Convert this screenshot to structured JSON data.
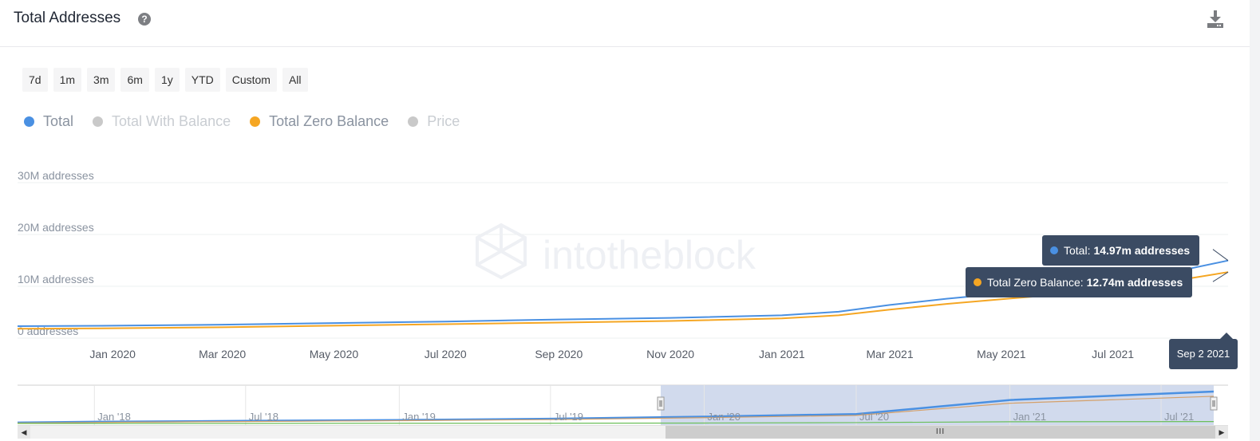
{
  "header": {
    "title": "Total Addresses",
    "help_icon": "question-circle-icon",
    "download_icon": "download-icon"
  },
  "range_buttons": [
    "7d",
    "1m",
    "3m",
    "6m",
    "1y",
    "YTD",
    "Custom",
    "All"
  ],
  "legend": [
    {
      "label": "Total",
      "color": "#4a90e2",
      "visible": true
    },
    {
      "label": "Total With Balance",
      "color": "#c9c9c9",
      "visible": false
    },
    {
      "label": "Total Zero Balance",
      "color": "#f5a623",
      "visible": true
    },
    {
      "label": "Price",
      "color": "#c9c9c9",
      "visible": false
    }
  ],
  "watermark": "intotheblock",
  "tooltip": {
    "total_label": "Total:",
    "total_value": "14.97m addresses",
    "zero_label": "Total Zero Balance:",
    "zero_value": "12.74m addresses",
    "date": "Sep 2 2021"
  },
  "chart_data": {
    "type": "line",
    "title": "Total Addresses",
    "xlabel": "",
    "ylabel": "",
    "y_ticks": [
      "0 addresses",
      "10M addresses",
      "20M addresses",
      "30M addresses"
    ],
    "ylim": [
      0,
      30
    ],
    "y_unit": "million addresses",
    "x_ticks": [
      "Jan 2020",
      "Mar 2020",
      "May 2020",
      "Jul 2020",
      "Sep 2020",
      "Nov 2020",
      "Jan 2021",
      "Mar 2021",
      "May 2021",
      "Jul 2021"
    ],
    "x": [
      "2019-11-10",
      "2020-01-01",
      "2020-03-01",
      "2020-05-01",
      "2020-07-01",
      "2020-09-01",
      "2020-11-01",
      "2021-01-01",
      "2021-02-01",
      "2021-03-01",
      "2021-04-01",
      "2021-05-01",
      "2021-06-01",
      "2021-07-01",
      "2021-08-01",
      "2021-09-02"
    ],
    "series": [
      {
        "name": "Total",
        "color": "#4a90e2",
        "values": [
          2.3,
          2.4,
          2.6,
          2.9,
          3.2,
          3.6,
          3.9,
          4.4,
          5.1,
          6.4,
          7.6,
          8.6,
          9.7,
          11.0,
          12.6,
          14.97
        ]
      },
      {
        "name": "Total Zero Balance",
        "color": "#f5a623",
        "values": [
          1.8,
          1.9,
          2.1,
          2.4,
          2.7,
          3.0,
          3.3,
          3.8,
          4.4,
          5.5,
          6.6,
          7.5,
          8.4,
          9.5,
          10.9,
          12.74
        ]
      }
    ],
    "grid": true,
    "legend_position": "top-left",
    "navigator": {
      "x_ticks": [
        "Jan '18",
        "Jul '18",
        "Jan '19",
        "Jul '19",
        "Jan '20",
        "Jul '20",
        "Jan '21",
        "Jul '21"
      ],
      "selected_range": [
        "2019-11-10",
        "2021-09-02"
      ],
      "series": [
        {
          "name": "Total",
          "color": "#4a90e2",
          "values": [
            0.4,
            0.8,
            1.2,
            1.6,
            2.2,
            3.2,
            4.4,
            11.0,
            14.97
          ]
        },
        {
          "name": "Total Zero Balance",
          "color": "#d4a06a",
          "values": [
            0.2,
            0.5,
            0.9,
            1.3,
            1.8,
            2.7,
            3.8,
            9.5,
            12.74
          ]
        },
        {
          "name": "Price",
          "color": "#6cbf5a",
          "values": [
            0.0,
            0.0,
            0.0,
            0.1,
            0.1,
            0.2,
            0.4,
            0.8,
            0.9
          ]
        }
      ],
      "x": [
        "2017-10-01",
        "2018-01-01",
        "2018-07-01",
        "2019-01-01",
        "2019-07-01",
        "2020-01-01",
        "2020-07-01",
        "2021-01-01",
        "2021-07-01"
      ]
    }
  }
}
